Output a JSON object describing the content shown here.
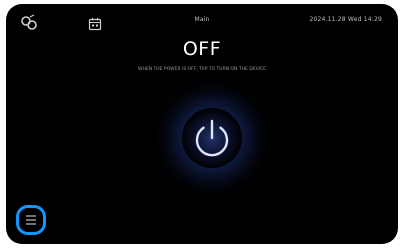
{
  "status_bar": {
    "left_icon": "broken-link-icon",
    "mid_icon": "calendar-icon",
    "title": "Main",
    "datetime": "2024.11.28 Wed 14:29"
  },
  "device": {
    "state_label": "OFF",
    "subtext": "WHEN THE POWER IS OFF, TAP TO TURN ON THE DEVICE"
  },
  "controls": {
    "power_icon": "power-icon",
    "menu_icon": "list-icon"
  },
  "colors": {
    "background": "#000000",
    "power_glow": "#2b47b3",
    "highlight_ring": "#1496ff"
  }
}
